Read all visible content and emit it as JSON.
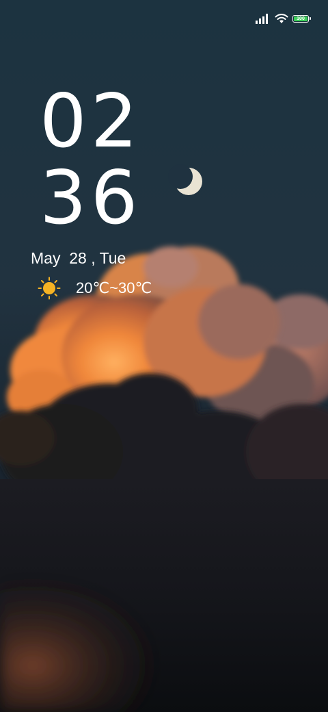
{
  "status_bar": {
    "battery_level": "100",
    "battery_color": "#3ecf5a",
    "icons": [
      "signal-icon",
      "wifi-icon",
      "battery-icon"
    ]
  },
  "lockscreen": {
    "hour": "02",
    "minute": "36",
    "date": "May  28 , Tue",
    "weather": {
      "icon": "sun-icon",
      "temperature": "20℃~30℃"
    }
  },
  "wallpaper": {
    "description_icon": "wallpaper-image",
    "sky_color": "#1f3240",
    "cloud_glow_color": "#f08a3c"
  }
}
